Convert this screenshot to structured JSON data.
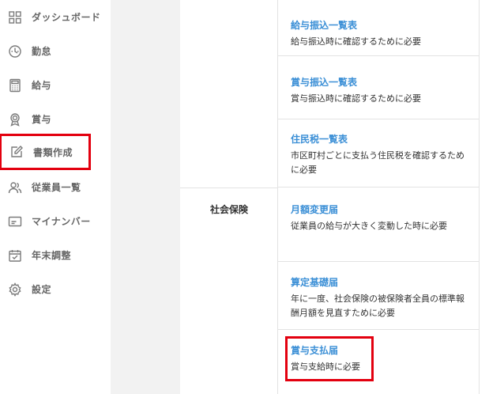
{
  "sidebar": {
    "items": [
      {
        "label": "ダッシュボード",
        "icon": "grid-icon"
      },
      {
        "label": "勤怠",
        "icon": "clock-icon"
      },
      {
        "label": "給与",
        "icon": "calculator-icon"
      },
      {
        "label": "賞与",
        "icon": "award-icon"
      },
      {
        "label": "書類作成",
        "icon": "edit-icon"
      },
      {
        "label": "従業員一覧",
        "icon": "users-icon"
      },
      {
        "label": "マイナンバー",
        "icon": "id-card-icon"
      },
      {
        "label": "年末調整",
        "icon": "calendar-icon"
      },
      {
        "label": "設定",
        "icon": "gear-icon"
      }
    ]
  },
  "table": {
    "category_social": "社会保険",
    "docs": [
      {
        "title": "給与振込一覧表",
        "desc": "給与振込時に確認するために必要"
      },
      {
        "title": "賞与振込一覧表",
        "desc": "賞与振込時に確認するために必要"
      },
      {
        "title": "住民税一覧表",
        "desc": "市区町村ごとに支払う住民税を確認するために必要"
      },
      {
        "title": "月額変更届",
        "desc": "従業員の給与が大きく変動した時に必要"
      },
      {
        "title": "算定基礎届",
        "desc": "年に一度、社会保険の被保険者全員の標準報酬月額を見直すために必要"
      },
      {
        "title": "賞与支払届",
        "desc": "賞与支給時に必要"
      }
    ]
  },
  "colors": {
    "link": "#3b8fd6",
    "highlight": "#e3000f",
    "gutter": "#f2f2f2"
  }
}
